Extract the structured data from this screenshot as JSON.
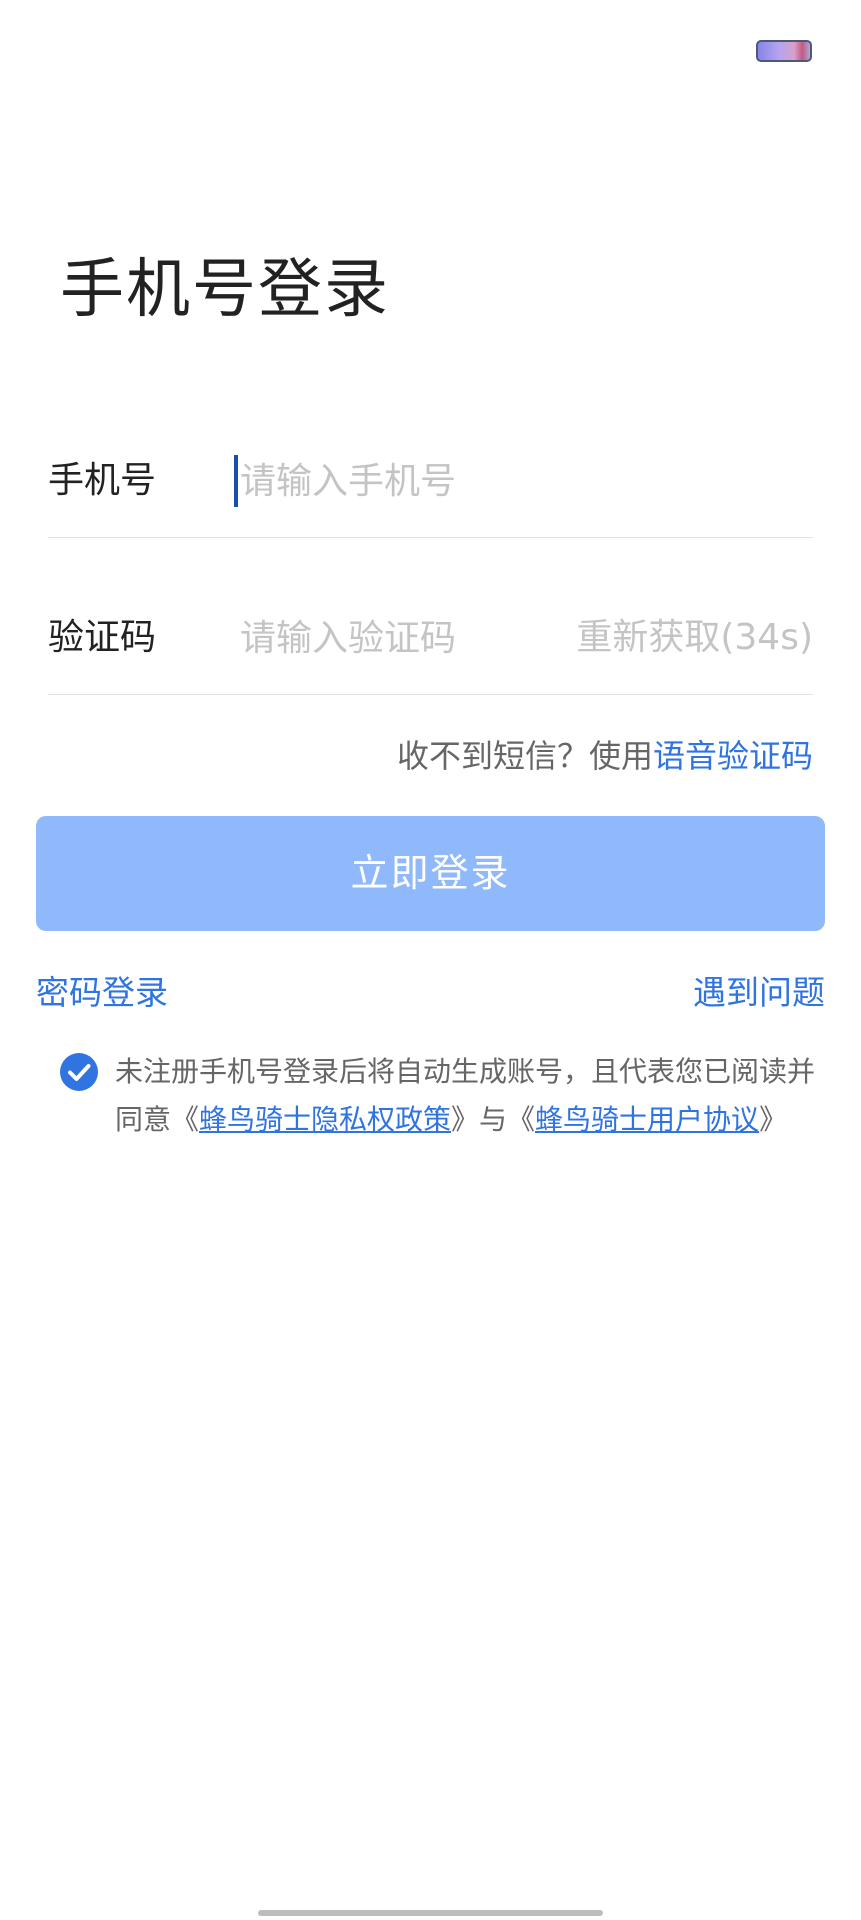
{
  "title": "手机号登录",
  "phone": {
    "label": "手机号",
    "placeholder": "请输入手机号",
    "value": ""
  },
  "code": {
    "label": "验证码",
    "placeholder": "请输入验证码",
    "value": "",
    "resend_label": "重新获取(34s)"
  },
  "sms_help": {
    "prefix": "收不到短信？使用",
    "link": "语音验证码"
  },
  "login_button": "立即登录",
  "links": {
    "password_login": "密码登录",
    "problems": "遇到问题"
  },
  "agreement": {
    "checked": true,
    "text_1": "未注册手机号登录后将自动生成账号，且代表您已阅读并同意《",
    "privacy_link": "蜂鸟骑士隐私权政策",
    "text_2": "》与《",
    "user_link": "蜂鸟骑士用户协议",
    "text_3": "》"
  },
  "icons": {
    "battery": "battery-icon",
    "check": "checkmark-icon"
  },
  "colors": {
    "accent": "#2f74e0",
    "button_disabled": "#8fb9fb",
    "placeholder": "#c4c4c4",
    "text": "#222222",
    "secondary_text": "#666666"
  }
}
